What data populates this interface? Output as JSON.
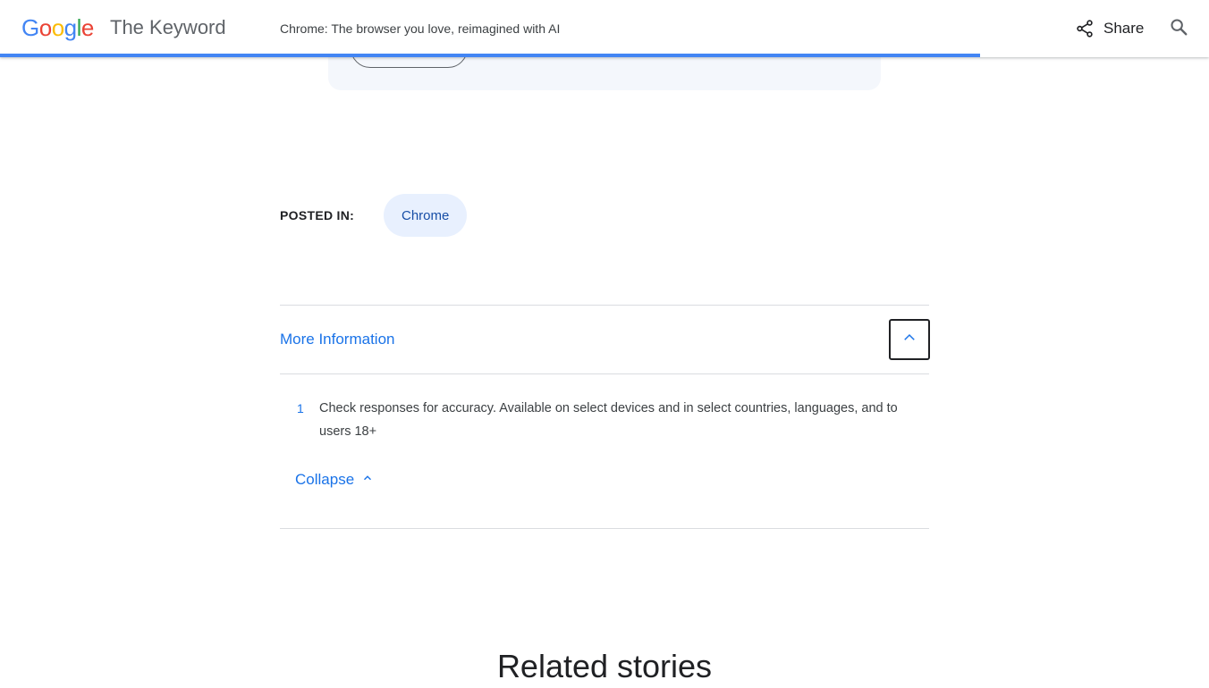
{
  "header": {
    "logo_letters": [
      {
        "char": "G",
        "color": "#4285f4"
      },
      {
        "char": "o",
        "color": "#ea4335"
      },
      {
        "char": "o",
        "color": "#fbbc05"
      },
      {
        "char": "g",
        "color": "#4285f4"
      },
      {
        "char": "l",
        "color": "#34a853"
      },
      {
        "char": "e",
        "color": "#ea4335"
      }
    ],
    "site_title": "The Keyword",
    "article_title": "Chrome: The browser you love, reimagined with AI",
    "share_label": "Share",
    "share_icon": "share-icon",
    "search_icon": "search-icon",
    "reading_progress": 0.811,
    "progress_color": "#4285f4"
  },
  "posted_in": {
    "label": "POSTED IN:",
    "tags": [
      "Chrome"
    ]
  },
  "more_info": {
    "title": "More Information",
    "expanded": true,
    "toggle_icon": "chevron-up-icon",
    "footnotes": [
      {
        "number": "1",
        "text": "Check responses for accuracy. Available on select devices and in select countries, languages, and to users 18+"
      }
    ],
    "collapse_label": "Collapse"
  },
  "related": {
    "heading": "Related stories"
  }
}
